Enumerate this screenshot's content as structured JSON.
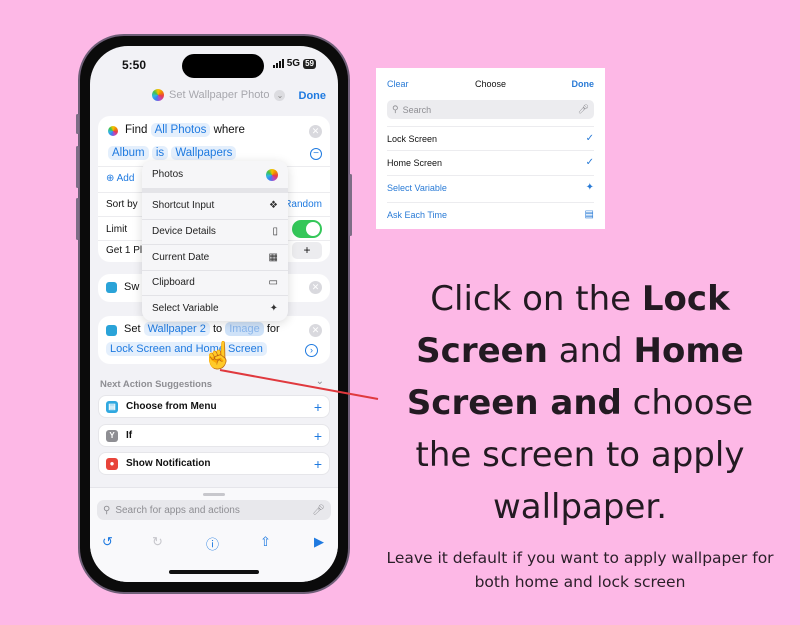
{
  "status_bar": {
    "time": "5:50",
    "network": "5G",
    "battery": "59"
  },
  "nav": {
    "title": "Set Wallpaper Photo",
    "done_label": "Done"
  },
  "find_action": {
    "verb": "Find",
    "source": "All Photos",
    "where": "where",
    "filter_field": "Album",
    "filter_op": "is",
    "filter_value": "Wallpapers",
    "add_filter_label": "Add",
    "sort_label": "Sort by",
    "sort_value": "Random",
    "limit_label": "Limit",
    "limit_enabled": true,
    "get_label": "Get 1 Pl"
  },
  "variable_menu": {
    "items": [
      {
        "label": "Photos",
        "icon": "photos-icon"
      },
      {
        "label": "Shortcut Input",
        "icon": "shortcut-input-icon"
      },
      {
        "label": "Device Details",
        "icon": "phone-icon"
      },
      {
        "label": "Current Date",
        "icon": "calendar-icon"
      },
      {
        "label": "Clipboard",
        "icon": "clipboard-icon"
      },
      {
        "label": "Select Variable",
        "icon": "magic-wand-icon"
      }
    ]
  },
  "switch_action": {
    "label": "Sw"
  },
  "set_action": {
    "verb": "Set",
    "target": "Wallpaper 2",
    "to": "to",
    "value": "Image",
    "for": "for",
    "screens": "Lock Screen and Home Screen"
  },
  "suggestions": {
    "header": "Next Action Suggestions",
    "items": [
      {
        "label": "Choose from Menu",
        "icon": "menu-icon",
        "color": "#2fa8e0"
      },
      {
        "label": "If",
        "icon": "if-icon",
        "color": "#8e8e93"
      },
      {
        "label": "Show Notification",
        "icon": "notification-icon",
        "color": "#e8443a"
      }
    ]
  },
  "bottom": {
    "search_placeholder": "Search for apps and actions"
  },
  "choose_panel": {
    "clear_label": "Clear",
    "title": "Choose",
    "done_label": "Done",
    "search_placeholder": "Search",
    "items": [
      {
        "label": "Lock Screen",
        "checked": true
      },
      {
        "label": "Home Screen",
        "checked": true
      },
      {
        "label": "Select Variable",
        "icon": "magic-wand-icon"
      },
      {
        "label": "Ask Each Time",
        "icon": "speech-bubble-icon"
      }
    ]
  },
  "instruction": {
    "p1": "Click on the ",
    "b1": "Lock Screen",
    "p2": " and ",
    "b2": "Home Screen and",
    "p3": " choose the  screen to apply wallpaper."
  },
  "note": "Leave it default if you want to apply wallpaper for both home and lock screen",
  "colors": {
    "background": "#fdb8e6",
    "accent": "#1f7ae0",
    "toggle_on": "#34c759",
    "pointer_line": "#e0393e"
  }
}
